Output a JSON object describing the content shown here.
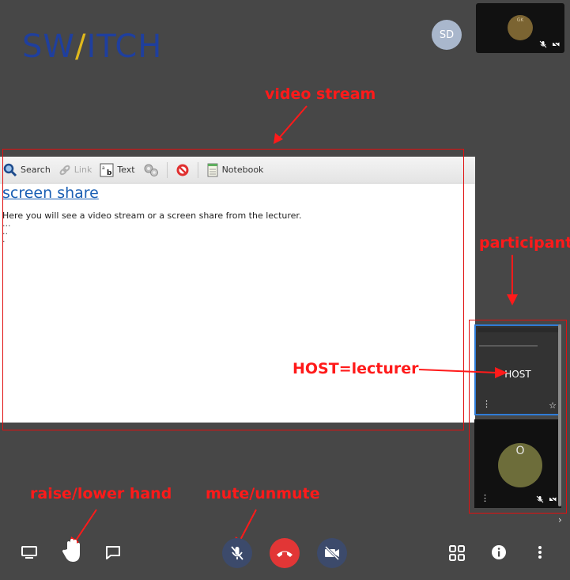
{
  "logo": {
    "text_pre": "SW",
    "text_v": "/",
    "text_post": "ITCH"
  },
  "top": {
    "avatar_initials": "SD",
    "selfview_initials": "GK"
  },
  "stage": {
    "toolbar": [
      {
        "label": "Search",
        "icon": "search-icon"
      },
      {
        "label": "Link",
        "icon": "link-icon",
        "disabled": true
      },
      {
        "label": "Text",
        "icon": "text-icon"
      },
      {
        "label": "Notebook",
        "icon": "notebook-icon"
      }
    ],
    "title": "screen share",
    "description": "Here you will see a video stream or a screen share from the lecturer.",
    "dots": "...\n..\n."
  },
  "participants": {
    "host_label": "HOST",
    "other_initial": "O"
  },
  "annotations": {
    "video_stream": "video stream",
    "participants": "participants",
    "host": "HOST=lecturer",
    "raise_hand": "raise/lower hand",
    "mute": "mute/unmute"
  },
  "colors": {
    "annotation": "#ff1a1a",
    "background": "#474747",
    "hangup": "#e23636",
    "host_border": "#2f7cd6"
  }
}
